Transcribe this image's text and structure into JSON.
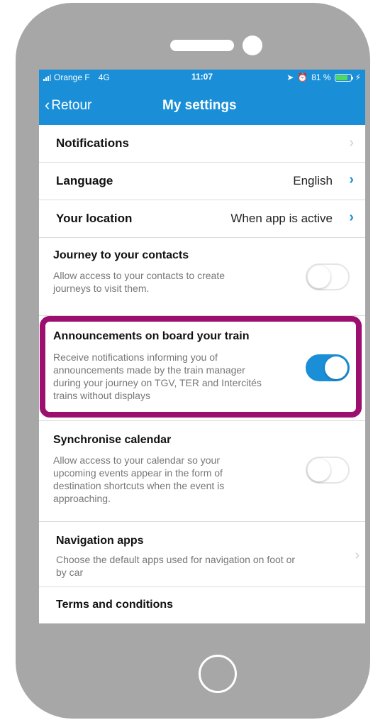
{
  "status_bar": {
    "carrier": "Orange F",
    "network": "4G",
    "time": "11:07",
    "battery": "81 %"
  },
  "nav": {
    "back_label": "Retour",
    "title": "My settings"
  },
  "settings": {
    "notifications": {
      "title": "Notifications"
    },
    "language": {
      "title": "Language",
      "value": "English"
    },
    "location": {
      "title": "Your location",
      "value": "When app is active"
    },
    "contacts": {
      "title": "Journey to your contacts",
      "desc_1": "Allow access to your contacts to create",
      "desc_2": "journeys to visit them.",
      "enabled": false
    },
    "announcements": {
      "title": "Announcements on board your train",
      "desc_1": "Receive notifications informing you of",
      "desc_2": "announcements made by the train manager",
      "desc_3": "during your journey on TGV, TER and Intercités",
      "desc_4": "trains without displays",
      "enabled": true
    },
    "calendar": {
      "title": "Synchronise calendar",
      "desc_1": "Allow access to your calendar so your",
      "desc_2": "upcoming events appear in the form of",
      "desc_3": "destination shortcuts when the event is",
      "desc_4": "approaching.",
      "enabled": false
    },
    "navigation_apps": {
      "title": "Navigation apps",
      "desc_1": "Choose the default apps used for navigation on foot or",
      "desc_2": "by car"
    },
    "terms": {
      "title": "Terms and conditions"
    }
  },
  "colors": {
    "header": "#1a8fd8",
    "highlight": "#9c0f6e",
    "phone_body": "#a7a7a7"
  }
}
